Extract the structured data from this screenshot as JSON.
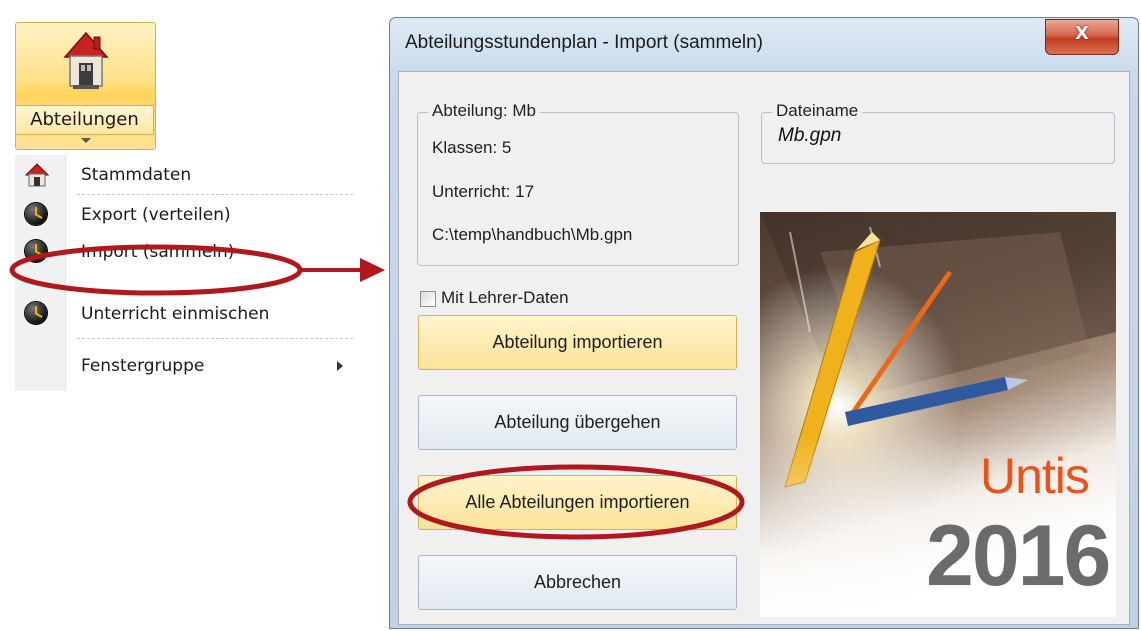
{
  "ribbon": {
    "label": "Abteilungen",
    "icon": "house-icon"
  },
  "menu": {
    "items": [
      {
        "label": "Stammdaten",
        "icon": "house-icon"
      },
      {
        "label": "Export (verteilen)",
        "icon": "clock-icon"
      },
      {
        "label": "Import (sammeln)",
        "icon": "clock-icon"
      },
      {
        "label": "Unterricht einmischen",
        "icon": "clock-icon"
      },
      {
        "label": "Fenstergruppe",
        "icon": "",
        "has_submenu": true
      }
    ]
  },
  "dialog": {
    "title": "Abteilungsstundenplan - Import (sammeln)",
    "close_label": "X",
    "department_group": {
      "legend": "Abteilung: Mb",
      "classes": "Klassen: 5",
      "lessons": "Unterricht: 17",
      "path": "C:\\temp\\handbuch\\Mb.gpn"
    },
    "file_group": {
      "legend": "Dateiname",
      "filename": "Mb.gpn"
    },
    "checkbox": {
      "label": "Mit Lehrer-Daten",
      "checked": false
    },
    "buttons": {
      "import": "Abteilung importieren",
      "skip": "Abteilung übergehen",
      "import_all": "Alle Abteilungen importieren",
      "cancel": "Abbrechen"
    },
    "splash": {
      "brand": "Untis",
      "year": "2016"
    }
  },
  "colors": {
    "highlight": "#b0181d",
    "accent_yellow": "#ffe08a",
    "brand_orange": "#e8541a"
  }
}
